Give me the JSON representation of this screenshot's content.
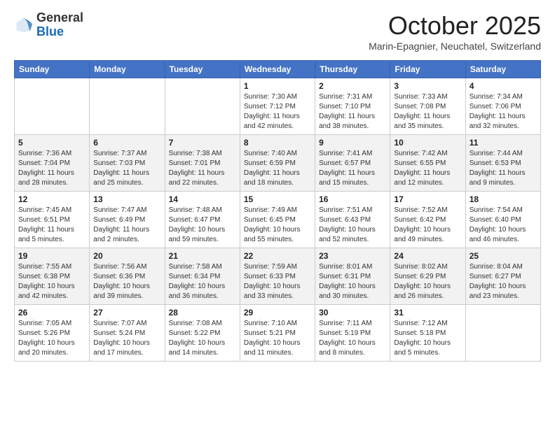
{
  "logo": {
    "general": "General",
    "blue": "Blue"
  },
  "header": {
    "month": "October 2025",
    "location": "Marin-Epagnier, Neuchatel, Switzerland"
  },
  "weekdays": [
    "Sunday",
    "Monday",
    "Tuesday",
    "Wednesday",
    "Thursday",
    "Friday",
    "Saturday"
  ],
  "weeks": [
    [
      {
        "day": "",
        "info": ""
      },
      {
        "day": "",
        "info": ""
      },
      {
        "day": "",
        "info": ""
      },
      {
        "day": "1",
        "info": "Sunrise: 7:30 AM\nSunset: 7:12 PM\nDaylight: 11 hours and 42 minutes."
      },
      {
        "day": "2",
        "info": "Sunrise: 7:31 AM\nSunset: 7:10 PM\nDaylight: 11 hours and 38 minutes."
      },
      {
        "day": "3",
        "info": "Sunrise: 7:33 AM\nSunset: 7:08 PM\nDaylight: 11 hours and 35 minutes."
      },
      {
        "day": "4",
        "info": "Sunrise: 7:34 AM\nSunset: 7:06 PM\nDaylight: 11 hours and 32 minutes."
      }
    ],
    [
      {
        "day": "5",
        "info": "Sunrise: 7:36 AM\nSunset: 7:04 PM\nDaylight: 11 hours and 28 minutes."
      },
      {
        "day": "6",
        "info": "Sunrise: 7:37 AM\nSunset: 7:03 PM\nDaylight: 11 hours and 25 minutes."
      },
      {
        "day": "7",
        "info": "Sunrise: 7:38 AM\nSunset: 7:01 PM\nDaylight: 11 hours and 22 minutes."
      },
      {
        "day": "8",
        "info": "Sunrise: 7:40 AM\nSunset: 6:59 PM\nDaylight: 11 hours and 18 minutes."
      },
      {
        "day": "9",
        "info": "Sunrise: 7:41 AM\nSunset: 6:57 PM\nDaylight: 11 hours and 15 minutes."
      },
      {
        "day": "10",
        "info": "Sunrise: 7:42 AM\nSunset: 6:55 PM\nDaylight: 11 hours and 12 minutes."
      },
      {
        "day": "11",
        "info": "Sunrise: 7:44 AM\nSunset: 6:53 PM\nDaylight: 11 hours and 9 minutes."
      }
    ],
    [
      {
        "day": "12",
        "info": "Sunrise: 7:45 AM\nSunset: 6:51 PM\nDaylight: 11 hours and 5 minutes."
      },
      {
        "day": "13",
        "info": "Sunrise: 7:47 AM\nSunset: 6:49 PM\nDaylight: 11 hours and 2 minutes."
      },
      {
        "day": "14",
        "info": "Sunrise: 7:48 AM\nSunset: 6:47 PM\nDaylight: 10 hours and 59 minutes."
      },
      {
        "day": "15",
        "info": "Sunrise: 7:49 AM\nSunset: 6:45 PM\nDaylight: 10 hours and 55 minutes."
      },
      {
        "day": "16",
        "info": "Sunrise: 7:51 AM\nSunset: 6:43 PM\nDaylight: 10 hours and 52 minutes."
      },
      {
        "day": "17",
        "info": "Sunrise: 7:52 AM\nSunset: 6:42 PM\nDaylight: 10 hours and 49 minutes."
      },
      {
        "day": "18",
        "info": "Sunrise: 7:54 AM\nSunset: 6:40 PM\nDaylight: 10 hours and 46 minutes."
      }
    ],
    [
      {
        "day": "19",
        "info": "Sunrise: 7:55 AM\nSunset: 6:38 PM\nDaylight: 10 hours and 42 minutes."
      },
      {
        "day": "20",
        "info": "Sunrise: 7:56 AM\nSunset: 6:36 PM\nDaylight: 10 hours and 39 minutes."
      },
      {
        "day": "21",
        "info": "Sunrise: 7:58 AM\nSunset: 6:34 PM\nDaylight: 10 hours and 36 minutes."
      },
      {
        "day": "22",
        "info": "Sunrise: 7:59 AM\nSunset: 6:33 PM\nDaylight: 10 hours and 33 minutes."
      },
      {
        "day": "23",
        "info": "Sunrise: 8:01 AM\nSunset: 6:31 PM\nDaylight: 10 hours and 30 minutes."
      },
      {
        "day": "24",
        "info": "Sunrise: 8:02 AM\nSunset: 6:29 PM\nDaylight: 10 hours and 26 minutes."
      },
      {
        "day": "25",
        "info": "Sunrise: 8:04 AM\nSunset: 6:27 PM\nDaylight: 10 hours and 23 minutes."
      }
    ],
    [
      {
        "day": "26",
        "info": "Sunrise: 7:05 AM\nSunset: 5:26 PM\nDaylight: 10 hours and 20 minutes."
      },
      {
        "day": "27",
        "info": "Sunrise: 7:07 AM\nSunset: 5:24 PM\nDaylight: 10 hours and 17 minutes."
      },
      {
        "day": "28",
        "info": "Sunrise: 7:08 AM\nSunset: 5:22 PM\nDaylight: 10 hours and 14 minutes."
      },
      {
        "day": "29",
        "info": "Sunrise: 7:10 AM\nSunset: 5:21 PM\nDaylight: 10 hours and 11 minutes."
      },
      {
        "day": "30",
        "info": "Sunrise: 7:11 AM\nSunset: 5:19 PM\nDaylight: 10 hours and 8 minutes."
      },
      {
        "day": "31",
        "info": "Sunrise: 7:12 AM\nSunset: 5:18 PM\nDaylight: 10 hours and 5 minutes."
      },
      {
        "day": "",
        "info": ""
      }
    ]
  ]
}
